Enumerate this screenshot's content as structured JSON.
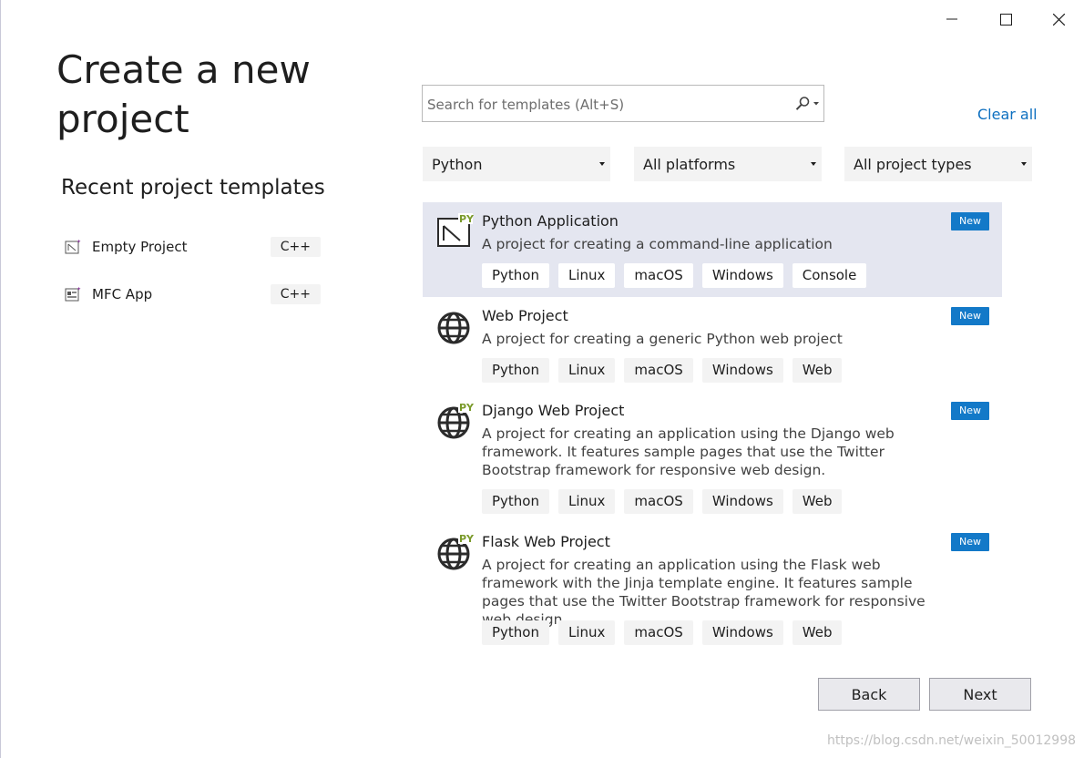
{
  "window": {
    "controls": {
      "minimize": "minimize-icon",
      "maximize": "maximize-icon",
      "close": "close-icon"
    }
  },
  "header": {
    "title": "Create a new project"
  },
  "recent": {
    "heading": "Recent project templates",
    "items": [
      {
        "label": "Empty Project",
        "tag": "C++",
        "icon": "empty-project-icon"
      },
      {
        "label": "MFC App",
        "tag": "C++",
        "icon": "mfc-app-icon"
      }
    ]
  },
  "search": {
    "placeholder": "Search for templates (Alt+S)",
    "value": ""
  },
  "clear_all": "Clear all",
  "filters": {
    "language": "Python",
    "platform": "All platforms",
    "project_type": "All project types"
  },
  "badge_new": "New",
  "templates": [
    {
      "name": "Python Application",
      "description": "A project for creating a command-line application",
      "tags": [
        "Python",
        "Linux",
        "macOS",
        "Windows",
        "Console"
      ],
      "selected": true,
      "icon": "python-application-icon"
    },
    {
      "name": "Web Project",
      "description": "A project for creating a generic Python web project",
      "tags": [
        "Python",
        "Linux",
        "macOS",
        "Windows",
        "Web"
      ],
      "icon": "globe-icon"
    },
    {
      "name": "Django Web Project",
      "description": "A project for creating an application using the Django web framework. It features sample pages that use the Twitter Bootstrap framework for responsive web design.",
      "tags": [
        "Python",
        "Linux",
        "macOS",
        "Windows",
        "Web"
      ],
      "icon": "globe-python-icon"
    },
    {
      "name": "Flask Web Project",
      "description": "A project for creating an application using the Flask web framework with the Jinja template engine. It features sample pages that use the Twitter Bootstrap framework for responsive web design.",
      "tags": [
        "Python",
        "Linux",
        "macOS",
        "Windows",
        "Web"
      ],
      "icon": "globe-python-icon"
    }
  ],
  "footer": {
    "back_label": "Back",
    "next_label": "Next"
  },
  "watermark": "https://blog.csdn.net/weixin_50012998",
  "colors": {
    "accent": "#0e70c0",
    "badge": "#1379c8",
    "selected_row": "#e4e6f0",
    "python_icon_green": "#7a9a2a"
  }
}
